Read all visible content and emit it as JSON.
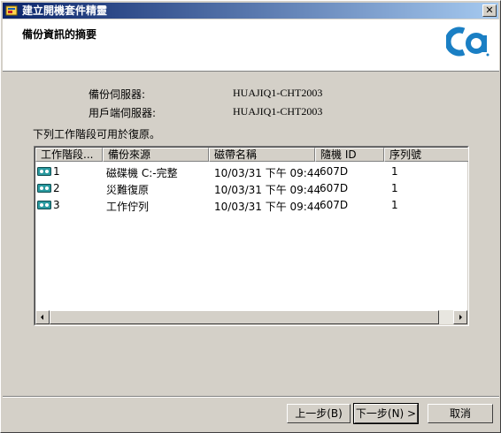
{
  "window": {
    "title": "建立開機套件精靈"
  },
  "header": {
    "title": "備份資訊的摘要"
  },
  "info": {
    "backup_server_label": "備份伺服器:",
    "backup_server_value": "HUAJIQ1-CHT2003",
    "client_server_label": "用戶端伺服器:",
    "client_server_value": "HUAJIQ1-CHT2003",
    "sessions_text": "下列工作階段可用於復原。"
  },
  "table": {
    "columns": [
      "工作階段...",
      "備份來源",
      "磁帶名稱",
      "隨機 ID",
      "序列號"
    ],
    "rows": [
      [
        "1",
        "磁碟機 C:-完整",
        "10/03/31 下午 09:44",
        "607D",
        "1"
      ],
      [
        "2",
        "災難復原",
        "10/03/31 下午 09:44",
        "607D",
        "1"
      ],
      [
        "3",
        "工作佇列",
        "10/03/31 下午 09:44",
        "607D",
        "1"
      ]
    ]
  },
  "buttons": {
    "back": "上一步(B)",
    "next": "下一步(N) >",
    "cancel": "取消"
  },
  "colors": {
    "titlebar_start": "#0a246a",
    "titlebar_end": "#a6caf0",
    "logo": "#1a7fc4",
    "tape_icon": "#2a9aa0"
  },
  "icons": {
    "close": "close-icon",
    "tape": "tape-icon",
    "logo": "ca-logo"
  }
}
